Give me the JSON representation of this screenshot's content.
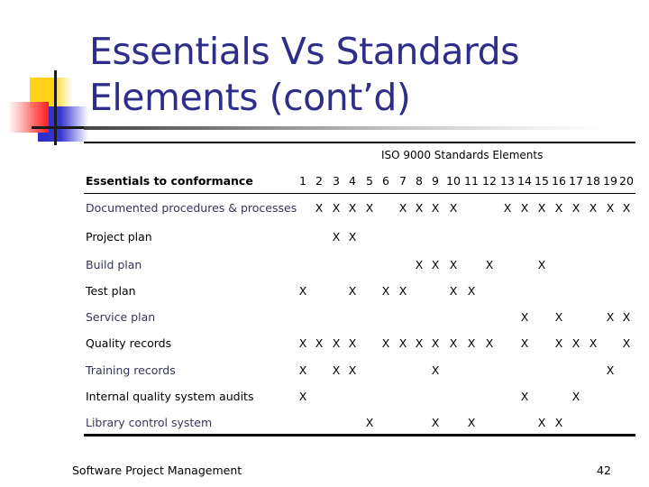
{
  "slide": {
    "title_line1": "Essentials Vs Standards",
    "title_line2": "Elements (cont’d)",
    "footer_text": "Software Project Management",
    "page_number": "42"
  },
  "table": {
    "group_header": "ISO 9000 Standards Elements",
    "row_header": "Essentials to conformance",
    "columns": [
      "1",
      "2",
      "3",
      "4",
      "5",
      "6",
      "7",
      "8",
      "9",
      "10",
      "11",
      "12",
      "13",
      "14",
      "15",
      "16",
      "17",
      "18",
      "19",
      "20"
    ],
    "mark_symbol": "X",
    "rows": [
      {
        "label": "Documented procedures & processes",
        "marks": [
          2,
          3,
          4,
          5,
          7,
          8,
          9,
          10,
          13,
          14,
          15,
          16,
          17,
          18,
          19,
          20
        ]
      },
      {
        "label": "Project plan",
        "marks": [
          3,
          4
        ]
      },
      {
        "label": "Build plan",
        "marks": [
          8,
          9,
          10,
          12,
          15
        ]
      },
      {
        "label": "Test plan",
        "marks": [
          1,
          4,
          6,
          7,
          10,
          11
        ]
      },
      {
        "label": "Service plan",
        "marks": [
          14,
          16,
          19,
          20
        ]
      },
      {
        "label": "Quality records",
        "marks": [
          1,
          2,
          3,
          4,
          6,
          7,
          8,
          9,
          10,
          11,
          12,
          14,
          16,
          17,
          18,
          20
        ]
      },
      {
        "label": "Training records",
        "marks": [
          1,
          3,
          4,
          9,
          19
        ]
      },
      {
        "label": "Internal quality system audits",
        "marks": [
          1,
          14,
          17
        ]
      },
      {
        "label": "Library control system",
        "marks": [
          5,
          9,
          11,
          15,
          16
        ]
      }
    ]
  },
  "colors": {
    "title": "#2e2e8a",
    "logo_yellow": "#ffd21a",
    "logo_red": "#ff2020",
    "logo_blue": "#2c2cc8"
  }
}
